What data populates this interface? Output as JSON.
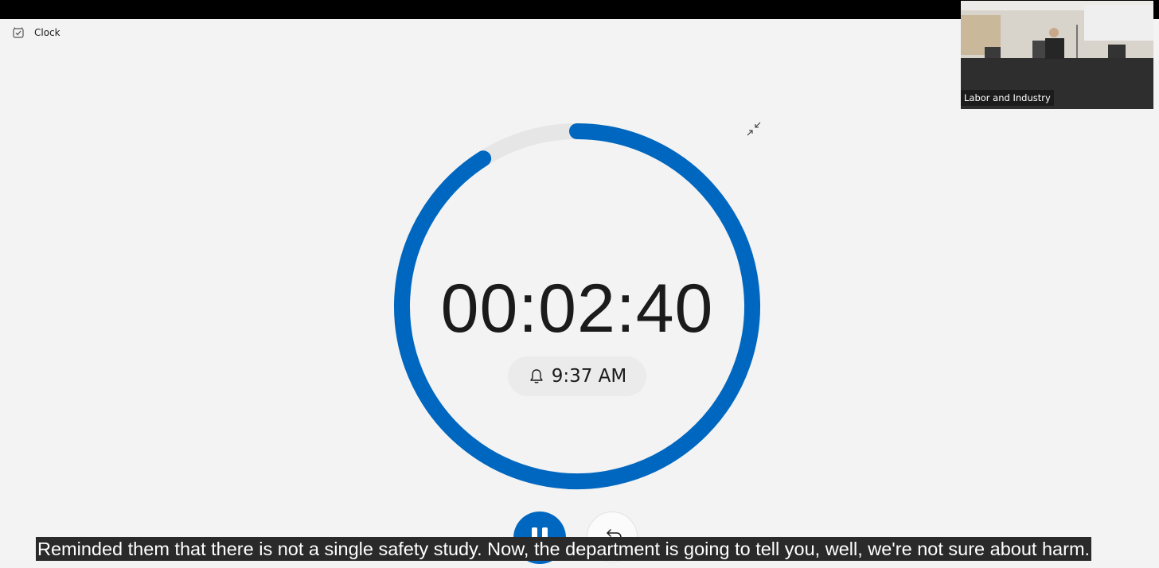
{
  "app": {
    "title": "Clock",
    "icon": "clock-app-icon"
  },
  "video": {
    "label": "Labor and Industry"
  },
  "timer": {
    "time": "00:02:40",
    "alarm_time": "9:37 AM",
    "progress_remaining": 0.91,
    "accent_color": "#0067c0",
    "track_color": "#e6e6e6"
  },
  "controls": {
    "pause_icon": "pause-icon",
    "reset_icon": "reset-icon",
    "collapse_icon": "collapse-icon"
  },
  "caption": {
    "text": "Reminded them that there is not a single safety study. Now, the department is going to tell you, well, we're not sure about harm."
  }
}
